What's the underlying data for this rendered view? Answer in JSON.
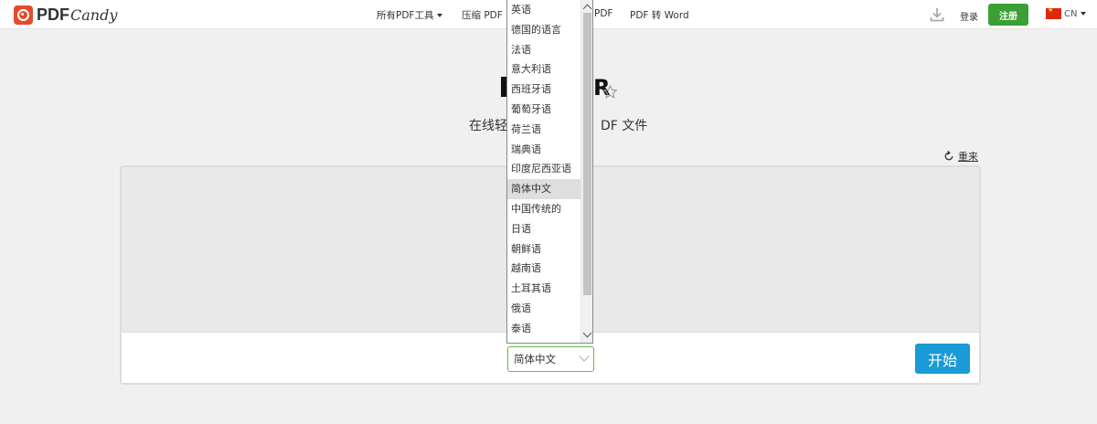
{
  "header": {
    "logo_pdf": "PDF",
    "logo_candy": "Candy",
    "nav": {
      "all_tools": "所有PDF工具",
      "compress": "压缩 PDF",
      "hidden_pdf": "PDF",
      "pdf_to_word": "PDF 转 Word"
    },
    "login": "登录",
    "register": "注册",
    "lang_code": "CN"
  },
  "main": {
    "title": "R",
    "subtitle_left": "在线轻",
    "subtitle_right": "DF 文件",
    "reset": "重来",
    "selected_language": "简体中文",
    "start": "开始"
  },
  "dropdown": {
    "items": [
      "英语",
      "德国的语言",
      "法语",
      "意大利语",
      "西班牙语",
      "葡萄牙语",
      "荷兰语",
      "瑞典语",
      "印度尼西亚语",
      "简体中文",
      "中国传统的",
      "日语",
      "朝鲜语",
      "越南语",
      "土耳其语",
      "俄语",
      "泰语"
    ],
    "selected_index": 9
  },
  "colors": {
    "brand": "#e44b2c",
    "register": "#3c9f36",
    "start": "#1a9ad6",
    "select_border": "#6ab84c"
  },
  "icons": {
    "logo": "pdfcandy-logo-icon",
    "download": "download-icon",
    "star": "star-icon",
    "reset": "refresh-icon",
    "flag": "china-flag-icon"
  }
}
